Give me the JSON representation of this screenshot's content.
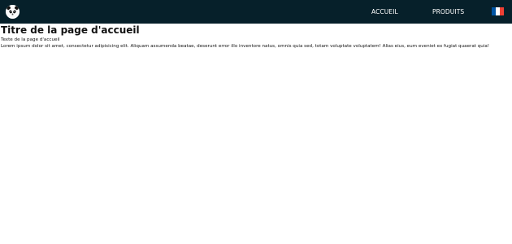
{
  "navbar": {
    "logo_icon": "panda-icon",
    "links": [
      {
        "label": "ACCUEIL"
      },
      {
        "label": "PRODUITS"
      }
    ],
    "language_icon": "france-flag-icon",
    "background_color": "#06202a",
    "text_color": "#ffffff"
  },
  "main": {
    "title": "Titre de la page d'accueil",
    "subtitle": "Texte de la page d'accueil",
    "body": "Lorem ipsum dolor sit amet, consectetur adipisicing elit. Aliquam assumenda beatae, deserunt error illo inventore natus, omnis quia sed, totam voluptate voluptatem! Alias eius, eum eveniet ex fugiat quaerat quia!"
  }
}
